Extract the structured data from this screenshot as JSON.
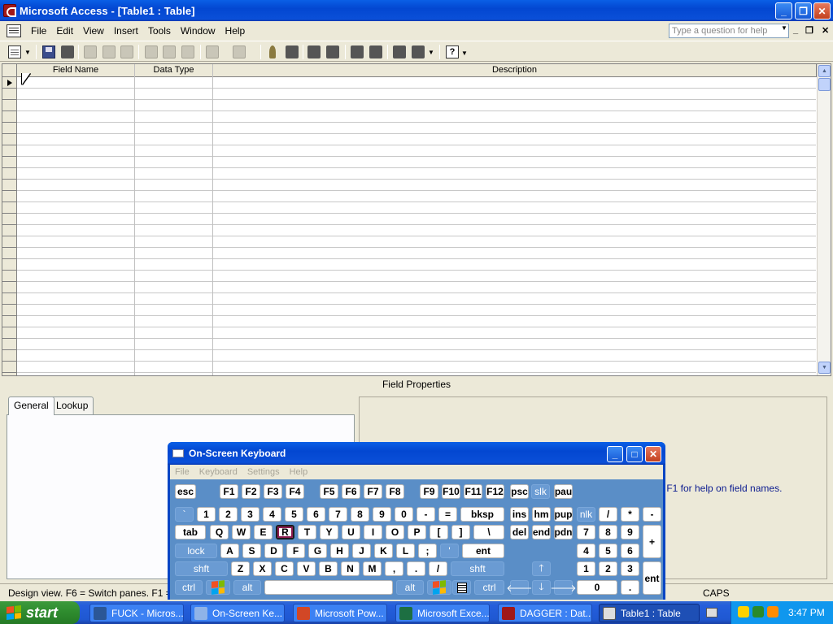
{
  "window": {
    "title": "Microsoft Access - [Table1 : Table]",
    "minimize": "_",
    "restore": "❐",
    "close": "✕"
  },
  "menu": {
    "items": [
      "File",
      "Edit",
      "View",
      "Insert",
      "Tools",
      "Window",
      "Help"
    ],
    "help_placeholder": "Type a question for help",
    "mdi_minimize": "_",
    "mdi_restore": "❐",
    "mdi_close": "✕"
  },
  "toolbar": {
    "icons": [
      "view-icon",
      "save-icon",
      "search-icon",
      "print-icon",
      "print-preview-icon",
      "spelling-icon",
      "cut-icon",
      "copy-icon",
      "paste-icon",
      "undo-icon",
      "redo-icon",
      "primary-key-icon",
      "indexes-icon",
      "insert-rows-icon",
      "delete-rows-icon",
      "properties-icon",
      "build-icon",
      "database-window-icon",
      "new-object-icon",
      "help-icon"
    ]
  },
  "design_grid": {
    "columns": [
      "Field Name",
      "Data Type",
      "Description"
    ]
  },
  "field_properties": {
    "title": "Field Properties",
    "tabs": [
      "General",
      "Lookup"
    ],
    "help_text": "ss F1 for help on field names."
  },
  "statusbar": {
    "text": "Design view.  F6 = Switch panes.  F1 = H",
    "caps": "CAPS"
  },
  "osk": {
    "title": "On-Screen Keyboard",
    "menu": [
      "File",
      "Keyboard",
      "Settings",
      "Help"
    ],
    "pressed_key": "R"
  },
  "taskbar": {
    "start_label": "start",
    "buttons": [
      {
        "label": "FUCK - Micros...",
        "icon_color": "#2b5797"
      },
      {
        "label": "On-Screen Ke...",
        "icon_color": "#8fb3e8"
      },
      {
        "label": "Microsoft Pow...",
        "icon_color": "#d24726"
      },
      {
        "label": "Microsoft Exce...",
        "icon_color": "#1d6f42"
      },
      {
        "label": "DAGGER : Dat...",
        "icon_color": "#a01818"
      },
      {
        "label": "Table1 : Table",
        "icon_color": "#dddddd"
      }
    ],
    "clock": "3:47 PM"
  },
  "colors": {
    "title_blue": "#0347d1",
    "osk_body": "#5a8ec7",
    "taskbar_blue": "#245edb",
    "start_green": "#2e8b2e",
    "tray_blue": "#0f97ee",
    "help_text": "#0b1b8f"
  }
}
